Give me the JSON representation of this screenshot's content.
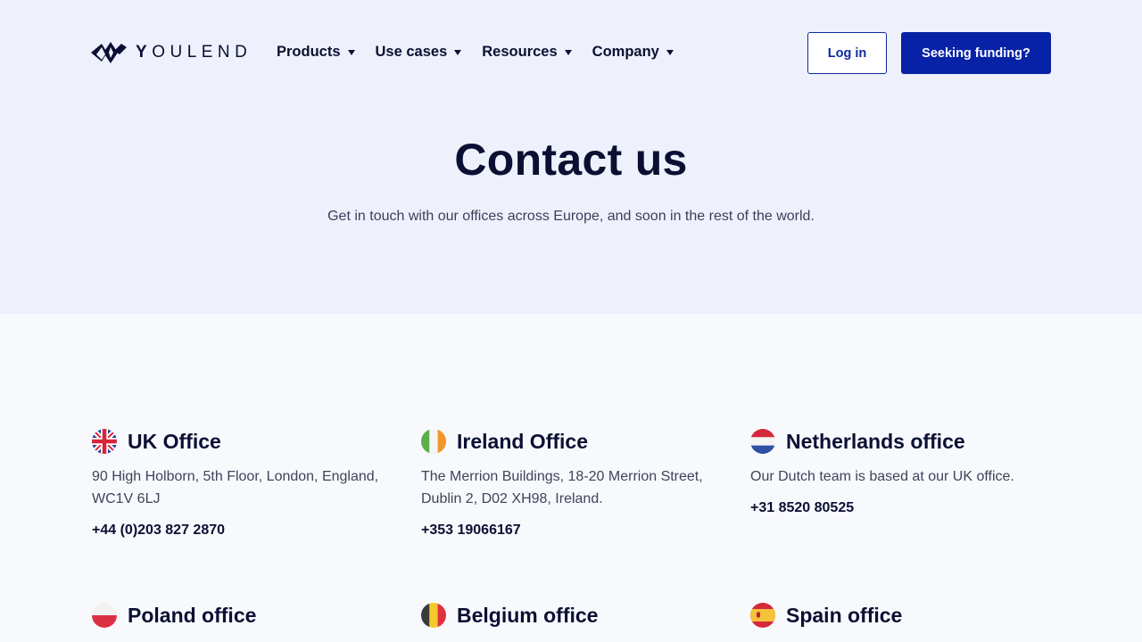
{
  "brand": {
    "name_y": "Y",
    "name_rest": "OULEND"
  },
  "nav": {
    "items": [
      {
        "label": "Products"
      },
      {
        "label": "Use cases"
      },
      {
        "label": "Resources"
      },
      {
        "label": "Company"
      }
    ],
    "login_label": "Log in",
    "funding_label": "Seeking funding?"
  },
  "hero": {
    "title": "Contact us",
    "subtitle": "Get in touch with our offices across Europe, and soon in the rest of the world."
  },
  "offices": [
    {
      "title": "UK Office",
      "address": "90 High Holborn, 5th Floor, London, England, WC1V 6LJ",
      "phone": "+44 (0)203 827 2870",
      "flag_icon": "uk-flag-icon"
    },
    {
      "title": "Ireland Office",
      "address": "The Merrion Buildings, 18-20 Merrion Street, Dublin 2, D02 XH98, Ireland.",
      "phone": "+353 19066167",
      "flag_icon": "ireland-flag-icon"
    },
    {
      "title": "Netherlands office",
      "address": "Our Dutch team is based at our UK office.",
      "phone": "+31 8520 80525",
      "flag_icon": "netherlands-flag-icon"
    },
    {
      "title": "Poland office",
      "flag_icon": "poland-flag-icon"
    },
    {
      "title": "Belgium office",
      "flag_icon": "belgium-flag-icon"
    },
    {
      "title": "Spain office",
      "flag_icon": "spain-flag-icon"
    }
  ],
  "colors": {
    "primary": "#0722a6",
    "text_dark": "#0b1033",
    "hero_bg": "#eef1fb"
  }
}
